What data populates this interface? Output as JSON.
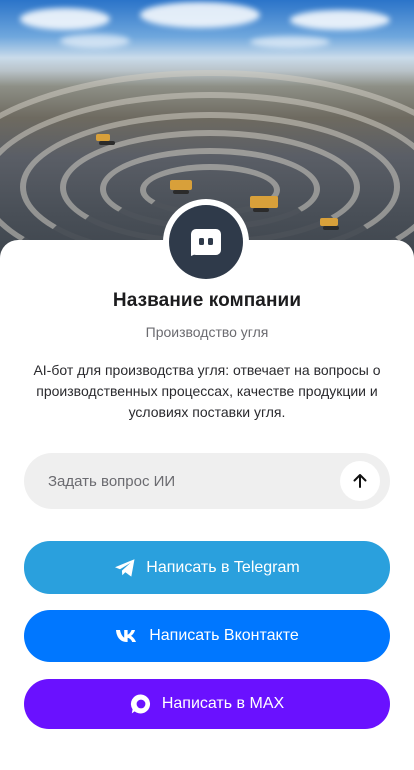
{
  "company": {
    "name": "Название компании",
    "category": "Производство угля",
    "description": "AI-бот для производства угля: отвечает на вопросы о производственных процессах, качестве продукции и условиях поставки угля."
  },
  "ask": {
    "placeholder": "Задать вопрос ИИ",
    "value": ""
  },
  "buttons": {
    "telegram": "Написать в Telegram",
    "vk": "Написать Вконтакте",
    "max": "Написать в MAX"
  },
  "icons": {
    "avatar": "chat-bot-icon",
    "send": "arrow-up-icon",
    "telegram": "telegram-icon",
    "vk": "vk-icon",
    "max": "max-icon"
  },
  "colors": {
    "telegram": "#2aa0dd",
    "vk": "#0077ff",
    "max": "#6a11ff",
    "avatar": "#2f3a4a",
    "input_bg": "#efefef"
  }
}
